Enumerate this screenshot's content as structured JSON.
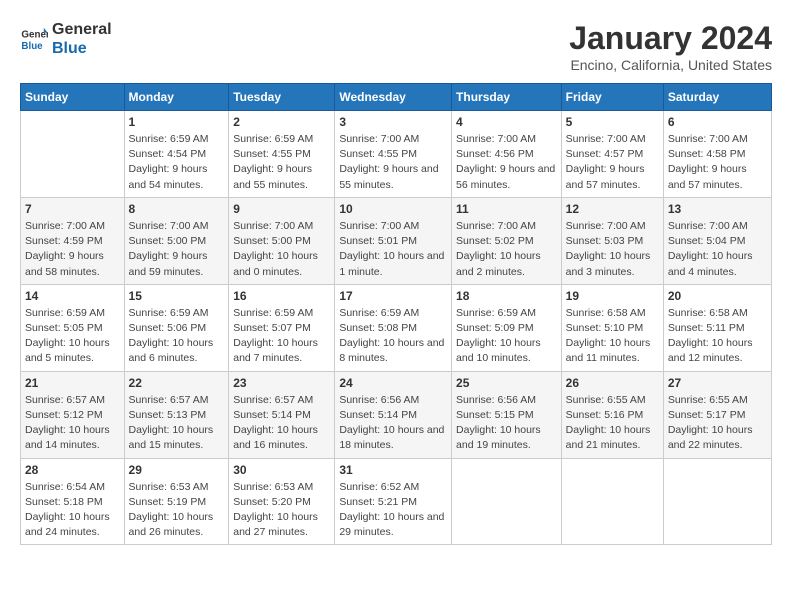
{
  "header": {
    "logo_line1": "General",
    "logo_line2": "Blue",
    "month_title": "January 2024",
    "location": "Encino, California, United States"
  },
  "weekdays": [
    "Sunday",
    "Monday",
    "Tuesday",
    "Wednesday",
    "Thursday",
    "Friday",
    "Saturday"
  ],
  "weeks": [
    [
      {
        "day": "",
        "sunrise": "",
        "sunset": "",
        "daylight": ""
      },
      {
        "day": "1",
        "sunrise": "Sunrise: 6:59 AM",
        "sunset": "Sunset: 4:54 PM",
        "daylight": "Daylight: 9 hours and 54 minutes."
      },
      {
        "day": "2",
        "sunrise": "Sunrise: 6:59 AM",
        "sunset": "Sunset: 4:55 PM",
        "daylight": "Daylight: 9 hours and 55 minutes."
      },
      {
        "day": "3",
        "sunrise": "Sunrise: 7:00 AM",
        "sunset": "Sunset: 4:55 PM",
        "daylight": "Daylight: 9 hours and 55 minutes."
      },
      {
        "day": "4",
        "sunrise": "Sunrise: 7:00 AM",
        "sunset": "Sunset: 4:56 PM",
        "daylight": "Daylight: 9 hours and 56 minutes."
      },
      {
        "day": "5",
        "sunrise": "Sunrise: 7:00 AM",
        "sunset": "Sunset: 4:57 PM",
        "daylight": "Daylight: 9 hours and 57 minutes."
      },
      {
        "day": "6",
        "sunrise": "Sunrise: 7:00 AM",
        "sunset": "Sunset: 4:58 PM",
        "daylight": "Daylight: 9 hours and 57 minutes."
      }
    ],
    [
      {
        "day": "7",
        "sunrise": "Sunrise: 7:00 AM",
        "sunset": "Sunset: 4:59 PM",
        "daylight": "Daylight: 9 hours and 58 minutes."
      },
      {
        "day": "8",
        "sunrise": "Sunrise: 7:00 AM",
        "sunset": "Sunset: 5:00 PM",
        "daylight": "Daylight: 9 hours and 59 minutes."
      },
      {
        "day": "9",
        "sunrise": "Sunrise: 7:00 AM",
        "sunset": "Sunset: 5:00 PM",
        "daylight": "Daylight: 10 hours and 0 minutes."
      },
      {
        "day": "10",
        "sunrise": "Sunrise: 7:00 AM",
        "sunset": "Sunset: 5:01 PM",
        "daylight": "Daylight: 10 hours and 1 minute."
      },
      {
        "day": "11",
        "sunrise": "Sunrise: 7:00 AM",
        "sunset": "Sunset: 5:02 PM",
        "daylight": "Daylight: 10 hours and 2 minutes."
      },
      {
        "day": "12",
        "sunrise": "Sunrise: 7:00 AM",
        "sunset": "Sunset: 5:03 PM",
        "daylight": "Daylight: 10 hours and 3 minutes."
      },
      {
        "day": "13",
        "sunrise": "Sunrise: 7:00 AM",
        "sunset": "Sunset: 5:04 PM",
        "daylight": "Daylight: 10 hours and 4 minutes."
      }
    ],
    [
      {
        "day": "14",
        "sunrise": "Sunrise: 6:59 AM",
        "sunset": "Sunset: 5:05 PM",
        "daylight": "Daylight: 10 hours and 5 minutes."
      },
      {
        "day": "15",
        "sunrise": "Sunrise: 6:59 AM",
        "sunset": "Sunset: 5:06 PM",
        "daylight": "Daylight: 10 hours and 6 minutes."
      },
      {
        "day": "16",
        "sunrise": "Sunrise: 6:59 AM",
        "sunset": "Sunset: 5:07 PM",
        "daylight": "Daylight: 10 hours and 7 minutes."
      },
      {
        "day": "17",
        "sunrise": "Sunrise: 6:59 AM",
        "sunset": "Sunset: 5:08 PM",
        "daylight": "Daylight: 10 hours and 8 minutes."
      },
      {
        "day": "18",
        "sunrise": "Sunrise: 6:59 AM",
        "sunset": "Sunset: 5:09 PM",
        "daylight": "Daylight: 10 hours and 10 minutes."
      },
      {
        "day": "19",
        "sunrise": "Sunrise: 6:58 AM",
        "sunset": "Sunset: 5:10 PM",
        "daylight": "Daylight: 10 hours and 11 minutes."
      },
      {
        "day": "20",
        "sunrise": "Sunrise: 6:58 AM",
        "sunset": "Sunset: 5:11 PM",
        "daylight": "Daylight: 10 hours and 12 minutes."
      }
    ],
    [
      {
        "day": "21",
        "sunrise": "Sunrise: 6:57 AM",
        "sunset": "Sunset: 5:12 PM",
        "daylight": "Daylight: 10 hours and 14 minutes."
      },
      {
        "day": "22",
        "sunrise": "Sunrise: 6:57 AM",
        "sunset": "Sunset: 5:13 PM",
        "daylight": "Daylight: 10 hours and 15 minutes."
      },
      {
        "day": "23",
        "sunrise": "Sunrise: 6:57 AM",
        "sunset": "Sunset: 5:14 PM",
        "daylight": "Daylight: 10 hours and 16 minutes."
      },
      {
        "day": "24",
        "sunrise": "Sunrise: 6:56 AM",
        "sunset": "Sunset: 5:14 PM",
        "daylight": "Daylight: 10 hours and 18 minutes."
      },
      {
        "day": "25",
        "sunrise": "Sunrise: 6:56 AM",
        "sunset": "Sunset: 5:15 PM",
        "daylight": "Daylight: 10 hours and 19 minutes."
      },
      {
        "day": "26",
        "sunrise": "Sunrise: 6:55 AM",
        "sunset": "Sunset: 5:16 PM",
        "daylight": "Daylight: 10 hours and 21 minutes."
      },
      {
        "day": "27",
        "sunrise": "Sunrise: 6:55 AM",
        "sunset": "Sunset: 5:17 PM",
        "daylight": "Daylight: 10 hours and 22 minutes."
      }
    ],
    [
      {
        "day": "28",
        "sunrise": "Sunrise: 6:54 AM",
        "sunset": "Sunset: 5:18 PM",
        "daylight": "Daylight: 10 hours and 24 minutes."
      },
      {
        "day": "29",
        "sunrise": "Sunrise: 6:53 AM",
        "sunset": "Sunset: 5:19 PM",
        "daylight": "Daylight: 10 hours and 26 minutes."
      },
      {
        "day": "30",
        "sunrise": "Sunrise: 6:53 AM",
        "sunset": "Sunset: 5:20 PM",
        "daylight": "Daylight: 10 hours and 27 minutes."
      },
      {
        "day": "31",
        "sunrise": "Sunrise: 6:52 AM",
        "sunset": "Sunset: 5:21 PM",
        "daylight": "Daylight: 10 hours and 29 minutes."
      },
      {
        "day": "",
        "sunrise": "",
        "sunset": "",
        "daylight": ""
      },
      {
        "day": "",
        "sunrise": "",
        "sunset": "",
        "daylight": ""
      },
      {
        "day": "",
        "sunrise": "",
        "sunset": "",
        "daylight": ""
      }
    ]
  ]
}
